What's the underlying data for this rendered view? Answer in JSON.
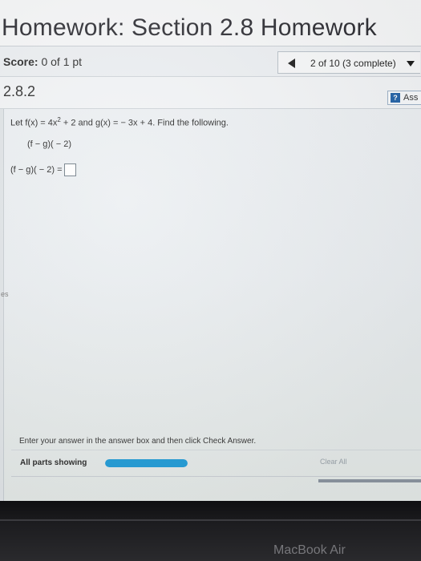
{
  "header": {
    "title": "Homework: Section 2.8 Homework"
  },
  "score_bar": {
    "score_label": "Score:",
    "score_value": "0 of 1 pt",
    "nav_text": "2 of 10 (3 complete)"
  },
  "question_bar": {
    "number": "2.8.2",
    "ask_label": "Ass"
  },
  "problem": {
    "prefix": "Let f(x) = 4x",
    "exponent": "2",
    "suffix": " + 2 and g(x) = − 3x + 4. Find the following.",
    "given": "(f − g)( − 2)",
    "answer_prompt": "(f − g)( − 2) ="
  },
  "left_rail": {
    "stray_text": "es"
  },
  "footer": {
    "instructions": "Enter your answer in the answer box and then click Check Answer.",
    "parts_label": "All parts showing",
    "progress_fraction": 1.0,
    "clear_label": "Clear All"
  },
  "device": {
    "brand": "MacBook Air"
  },
  "colors": {
    "progress": "#1f9ad6",
    "accent": "#2463a8"
  }
}
